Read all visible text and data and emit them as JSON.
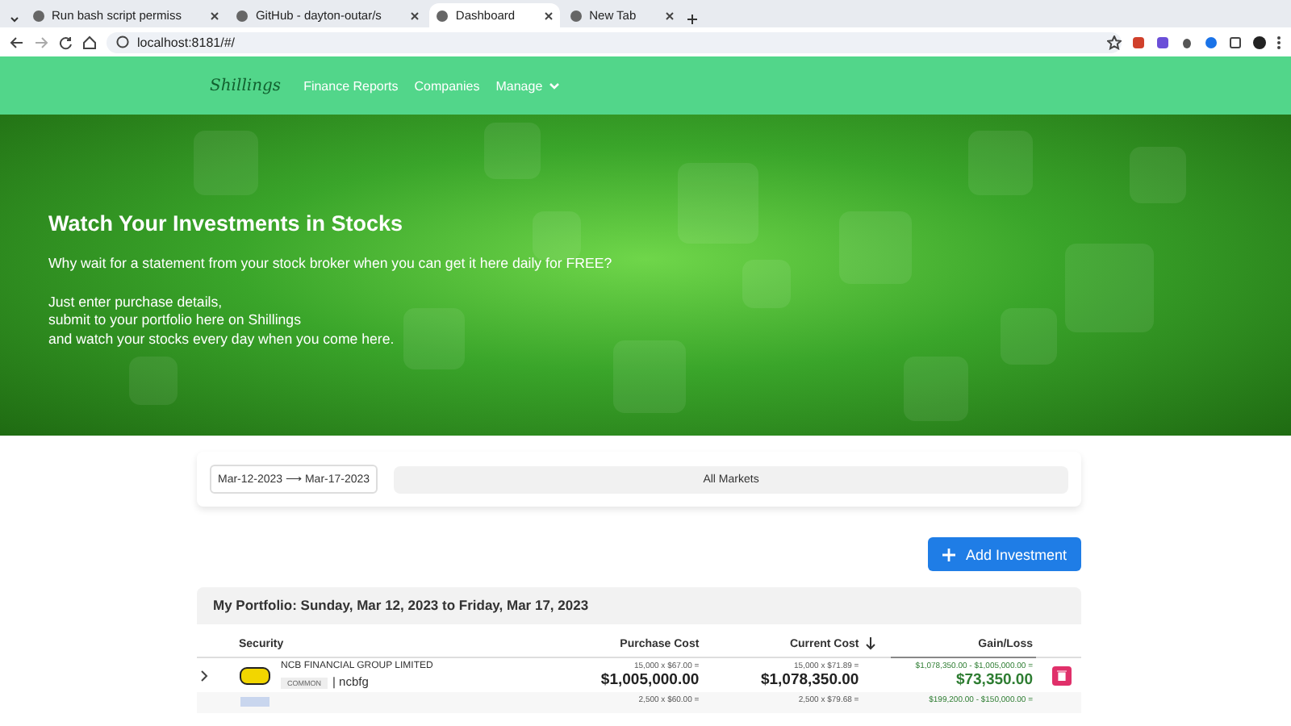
{
  "browser": {
    "tabs": [
      {
        "title": "Run bash script permiss",
        "selected": false
      },
      {
        "title": "GitHub - dayton-outar/s",
        "selected": false
      },
      {
        "title": "Dashboard",
        "selected": true
      },
      {
        "title": "New Tab",
        "selected": false
      }
    ],
    "address": "localhost:8181/#/"
  },
  "nav": {
    "logo": "Shillings",
    "links": [
      "Finance Reports",
      "Companies"
    ],
    "menu": "Manage"
  },
  "hero": {
    "title": "Watch Your Investments in Stocks",
    "paragraphs": [
      [
        "Why wait for a statement from your stock broker when you can get it here daily for FREE?"
      ],
      [
        "Just enter purchase details,",
        "submit to your portfolio here on Shillings",
        "and watch your stocks every day when you come here."
      ]
    ]
  },
  "filter": {
    "date_range": "Mar-12-2023 ⟶ Mar-17-2023",
    "market": "All Markets"
  },
  "add_button": "Add Investment",
  "portfolio": {
    "title": "My Portfolio: Sunday, Mar 12, 2023 to Friday, Mar 17, 2023",
    "columns": [
      "Security",
      "Purchase Cost",
      "Current Cost",
      "Gain/Loss"
    ],
    "rows": [
      {
        "name": "NCB FINANCIAL GROUP LIMITED",
        "type": "COMMON",
        "symbol": "| ncbfg",
        "purchase_calc": "15,000 x $67.00 =",
        "purchase_total": "$1,005,000.00",
        "current_calc": "15,000 x $71.89 =",
        "current_total": "$1,078,350.00",
        "gain_calc": "$1,078,350.00 - $1,005,000.00 =",
        "gain_total": "$73,350.00"
      },
      {
        "purchase_calc": "2,500 x $60.00 =",
        "current_calc": "2,500 x $79.68 =",
        "gain_calc": "$199,200.00 - $150,000.00 ="
      }
    ]
  }
}
